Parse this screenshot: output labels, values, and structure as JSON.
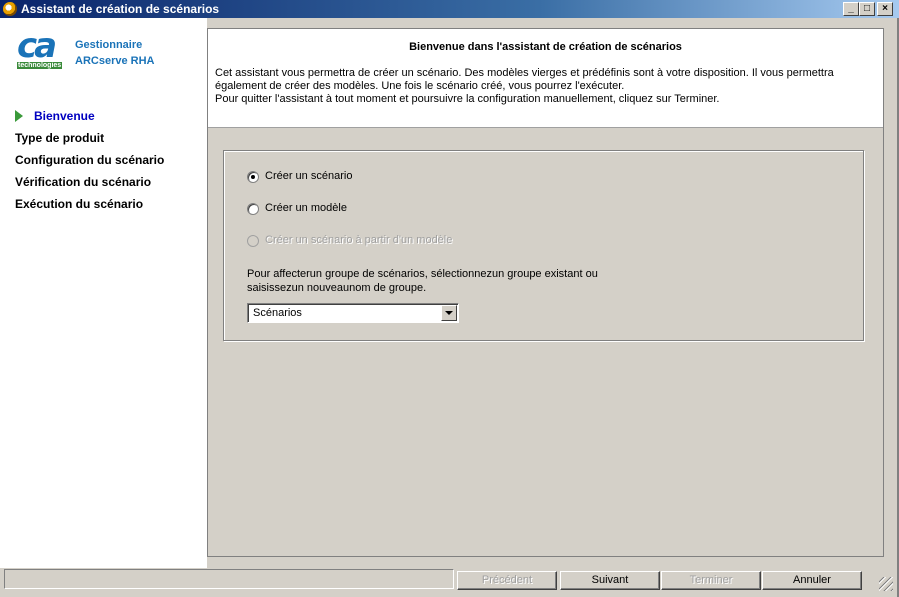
{
  "window": {
    "title": "Assistant de création de scénarios",
    "minimize_glyph": "_",
    "maximize_glyph": "□",
    "close_glyph": "×"
  },
  "sidebar": {
    "logo_text": "ca",
    "logo_subtext": "technologies",
    "product_line1": "Gestionnaire",
    "product_line2": "ARCserve RHA",
    "steps": [
      {
        "label": "Bienvenue",
        "active": true
      },
      {
        "label": "Type de produit",
        "active": false
      },
      {
        "label": "Configuration du scénario",
        "active": false
      },
      {
        "label": "Vérification du scénario",
        "active": false
      },
      {
        "label": "Exécution du scénario",
        "active": false
      }
    ]
  },
  "header": {
    "title": "Bienvenue dans l'assistant de création de scénarios",
    "line1": "Cet assistant vous permettra de créer un scénario. Des modèles vierges et prédéfinis sont à votre disposition. Il vous permettra",
    "line2": "également de créer des modèles. Une fois le scénario créé, vous pourrez l'exécuter.",
    "line3": "Pour quitter l'assistant à tout moment et poursuivre la configuration manuellement, cliquez sur Terminer."
  },
  "options": {
    "create_scenario": {
      "label": "Créer un scénario",
      "checked": true
    },
    "create_template": {
      "label": "Créer un modèle",
      "checked": false
    },
    "scenario_from_template": {
      "label": "Créer un scénario à partir d'un modèle",
      "enabled": false
    }
  },
  "group": {
    "description_line1": "Pour affecterun groupe de scénarios, sélectionnezun groupe existant ou",
    "description_line2": "saisissezun nouveaunom de groupe.",
    "selected": "Scénarios"
  },
  "buttons": {
    "previous": "Précédent",
    "next": "Suivant",
    "finish": "Terminer",
    "cancel": "Annuler"
  }
}
